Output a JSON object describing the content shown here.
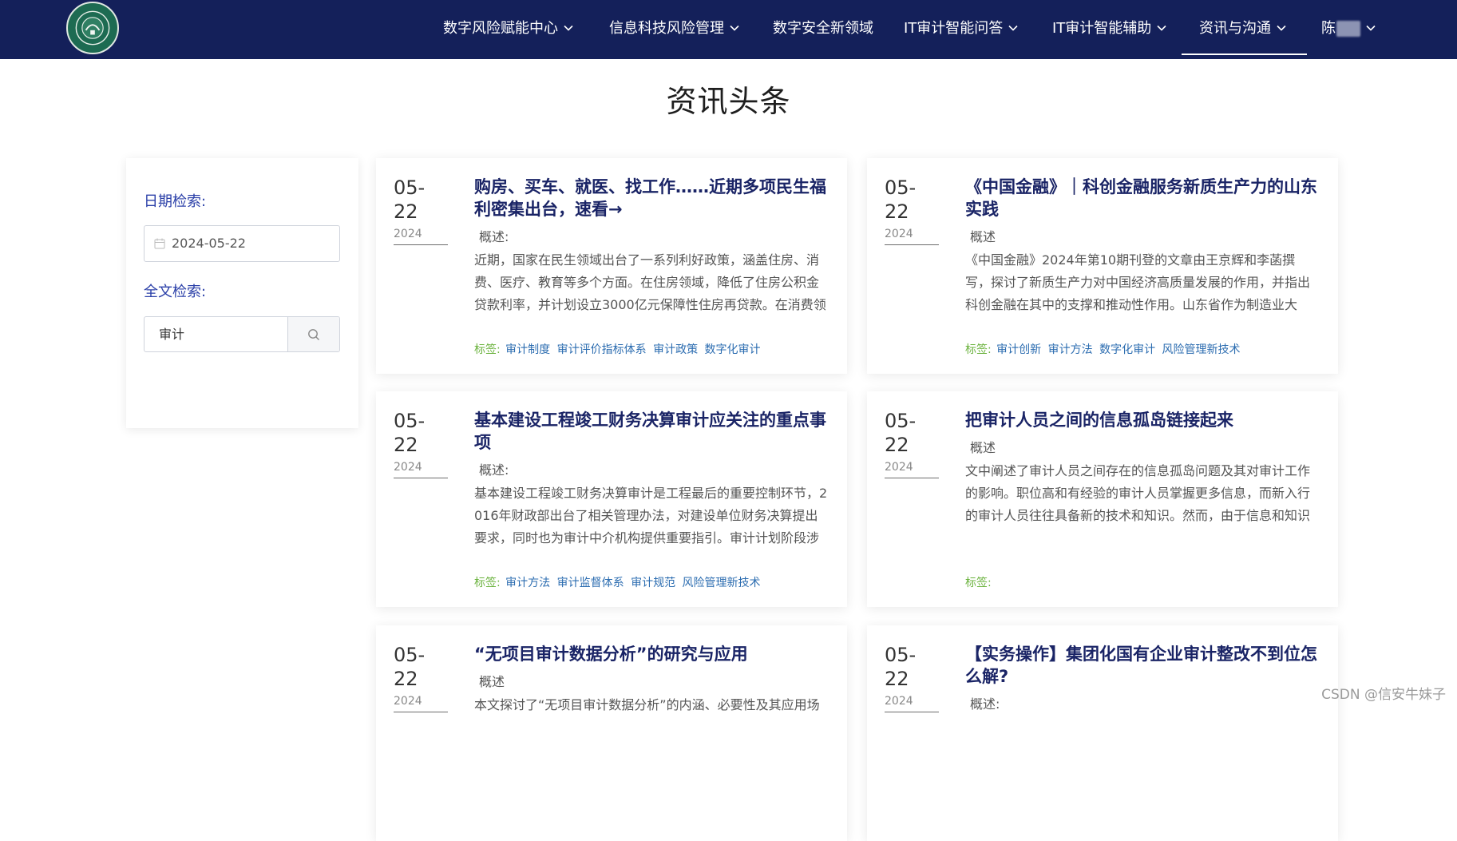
{
  "nav": {
    "items": [
      {
        "label": "数字风险赋能中心",
        "dropdown": true
      },
      {
        "label": "信息科技风险管理",
        "dropdown": true
      },
      {
        "label": "数字安全新领域",
        "dropdown": false
      },
      {
        "label": "IT审计智能问答",
        "dropdown": true
      },
      {
        "label": "IT审计智能辅助",
        "dropdown": true
      },
      {
        "label": "资讯与沟通",
        "dropdown": true,
        "active": true
      }
    ],
    "user_name": "陈"
  },
  "page_title": "资讯头条",
  "sidebar": {
    "date_label": "日期检索:",
    "date_value": "2024-05-22",
    "fulltext_label": "全文检索:",
    "search_value": "审计"
  },
  "tag_label": "标签:",
  "overview_label": "概述:",
  "cards": [
    {
      "date": "05-22",
      "year": "2024",
      "title": "购房、买车、就医、找工作……近期多项民生福利密集出台，速看→",
      "overview_label": "概述:",
      "summary": "近期，国家在民生领域出台了一系列利好政策，涵盖住房、消费、医疗、教育等多个方面。在住房领域，降低了住房公积金贷款利率，并计划设立3000亿元保障性住房再贷款。在消费领",
      "tags": [
        "审计制度",
        "审计评价指标体系",
        "审计政策",
        "数字化审计"
      ]
    },
    {
      "date": "05-22",
      "year": "2024",
      "title": "《中国金融》｜科创金融服务新质生产力的山东实践",
      "overview_label": "概述",
      "summary": "《中国金融》2024年第10期刊登的文章由王京辉和李菡撰写，探讨了新质生产力对中国经济高质量发展的作用，并指出科创金融在其中的支撑和推动性作用。山东省作为制造业大省，近年来",
      "tags": [
        "审计创新",
        "审计方法",
        "数字化审计",
        "风险管理新技术"
      ]
    },
    {
      "date": "05-22",
      "year": "2024",
      "title": "基本建设工程竣工财务决算审计应关注的重点事项",
      "overview_label": "概述:",
      "summary": "基本建设工程竣工财务决算审计是工程最后的重要控制环节，2016年财政部出台了相关管理办法，对建设单位财务决算提出要求，同时也为审计中介机构提供重要指引。审计计划阶段涉及业",
      "tags": [
        "审计方法",
        "审计监督体系",
        "审计规范",
        "风险管理新技术"
      ]
    },
    {
      "date": "05-22",
      "year": "2024",
      "title": "把审计人员之间的信息孤岛链接起来",
      "overview_label": "概述",
      "summary": "文中阐述了审计人员之间存在的信息孤岛问题及其对审计工作的影响。职位高和有经验的审计人员掌握更多信息，而新入行的审计人员往往具备新的技术和知识。然而，由于信息和知识共享的",
      "tags": []
    },
    {
      "date": "05-22",
      "year": "2024",
      "title": "“无项目审计数据分析”的研究与应用",
      "overview_label": "概述",
      "summary": "本文探讨了“无项目审计数据分析”的内涵、必要性及其应用场",
      "tags": []
    },
    {
      "date": "05-22",
      "year": "2024",
      "title": "【实务操作】集团化国有企业审计整改不到位怎么解?",
      "overview_label": "概述:",
      "summary": "",
      "tags": []
    }
  ],
  "watermark": "CSDN @信安牛妹子"
}
